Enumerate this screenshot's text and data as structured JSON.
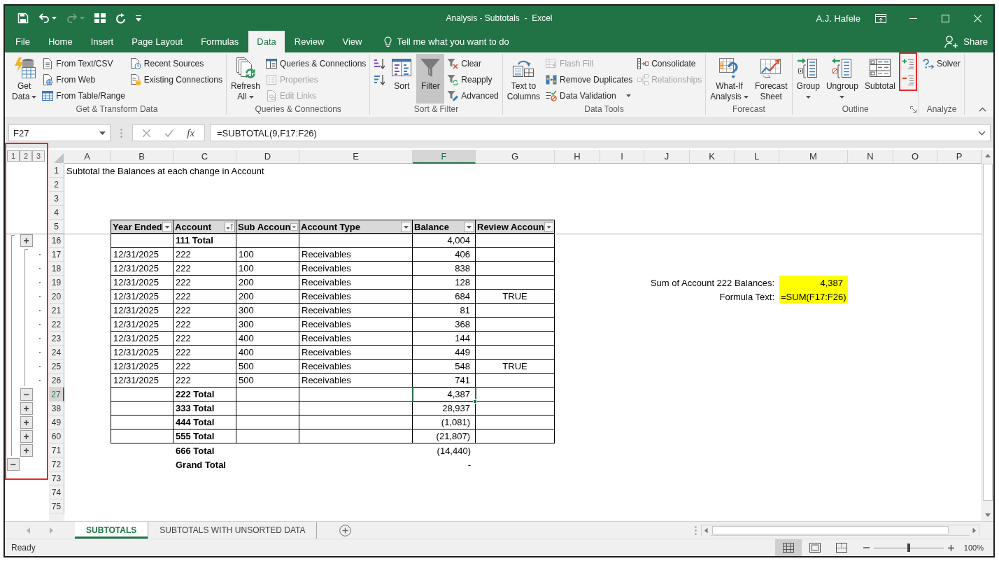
{
  "window": {
    "title": "Analysis - Subtotals  -  Excel",
    "user": "A.J. Hafele"
  },
  "quick_access": [
    {
      "kind": "save",
      "disabled": false
    },
    {
      "kind": "undo",
      "disabled": false,
      "dropdown": true
    },
    {
      "kind": "redo",
      "disabled": true,
      "dropdown": true
    },
    {
      "kind": "form",
      "disabled": false
    },
    {
      "kind": "refresh",
      "disabled": false
    },
    {
      "kind": "customize",
      "disabled": false
    }
  ],
  "tabs": [
    {
      "label": "File",
      "selected": false
    },
    {
      "label": "Home",
      "selected": false
    },
    {
      "label": "Insert",
      "selected": false
    },
    {
      "label": "Page Layout",
      "selected": false
    },
    {
      "label": "Formulas",
      "selected": false
    },
    {
      "label": "Data",
      "selected": true
    },
    {
      "label": "Review",
      "selected": false
    },
    {
      "label": "View",
      "selected": false
    }
  ],
  "tell_me": {
    "label": "Tell me what you want to do"
  },
  "share": {
    "label": "Share"
  },
  "ribbon": {
    "groups": [
      {
        "label": "Get & Transform Data",
        "columns": [
          {
            "kind": "large",
            "label": "Get\nData",
            "dropdown": true,
            "selected": false
          },
          {
            "kind": "stack",
            "items": [
              {
                "label": "From Text/CSV",
                "disabled": false
              },
              {
                "label": "From Web",
                "disabled": false
              },
              {
                "label": "From Table/Range",
                "disabled": false
              }
            ]
          },
          {
            "kind": "stack",
            "items": [
              {
                "label": "Recent Sources",
                "disabled": false
              },
              {
                "label": "Existing Connections",
                "disabled": false
              }
            ]
          }
        ]
      },
      {
        "label": "Queries & Connections",
        "columns": [
          {
            "kind": "large",
            "label": "Refresh\nAll",
            "dropdown": true,
            "selected": false
          },
          {
            "kind": "stack",
            "items": [
              {
                "label": "Queries & Connections",
                "disabled": false
              },
              {
                "label": "Properties",
                "disabled": true
              },
              {
                "label": "Edit Links",
                "disabled": true
              }
            ]
          }
        ]
      },
      {
        "label": "Sort & Filter",
        "columns": [
          {
            "kind": "stack",
            "items": [
              {
                "disabled": false
              },
              {
                "disabled": false
              }
            ]
          },
          {
            "kind": "large",
            "label": "Sort",
            "selected": false
          },
          {
            "kind": "large",
            "label": "Filter",
            "selected": true
          },
          {
            "kind": "stack",
            "items": [
              {
                "label": "Clear",
                "disabled": false
              },
              {
                "label": "Reapply",
                "disabled": false
              },
              {
                "label": "Advanced",
                "disabled": false
              }
            ]
          }
        ]
      },
      {
        "label": "Data Tools",
        "columns": [
          {
            "kind": "large",
            "label": "Text to\nColumns",
            "selected": false
          },
          {
            "kind": "stack",
            "items": [
              {
                "label": "Flash Fill",
                "disabled": true
              },
              {
                "label": "Remove Duplicates",
                "disabled": false
              },
              {
                "label": "Data Validation",
                "disabled": false,
                "dropdown": true
              }
            ]
          },
          {
            "kind": "stack",
            "items": [
              {
                "label": "Consolidate",
                "disabled": false
              },
              {
                "label": "Relationships",
                "disabled": true
              }
            ]
          }
        ]
      },
      {
        "label": "Forecast",
        "columns": [
          {
            "kind": "large",
            "label": "What-If\nAnalysis",
            "dropdown": true,
            "selected": false
          },
          {
            "kind": "large",
            "label": "Forecast\nSheet",
            "selected": false
          }
        ]
      },
      {
        "label": "Outline",
        "launcher": true,
        "columns": [
          {
            "kind": "large",
            "label": "Group",
            "dropdown": true,
            "selected": false
          },
          {
            "kind": "large",
            "label": "Ungroup",
            "dropdown": true,
            "selected": false
          },
          {
            "kind": "large",
            "label": "Subtotal",
            "selected": false
          },
          {
            "kind": "stack",
            "highlighted": true,
            "items": [
              {
                "disabled": false
              },
              {
                "disabled": false
              }
            ]
          }
        ]
      },
      {
        "label": "Analyze",
        "columns": [
          {
            "kind": "stack",
            "items": [
              {
                "label": "Solver",
                "disabled": false
              }
            ]
          }
        ]
      }
    ]
  },
  "formula_bar": {
    "name_box": "F27",
    "insert_function": "fx",
    "formula": "=SUBTOTAL(9,F17:F26)"
  },
  "sheet": {
    "outline": {
      "levels": [
        "1",
        "2",
        "3"
      ],
      "highlighted": true
    },
    "columns": [
      {
        "label": "A",
        "selected": false
      },
      {
        "label": "B",
        "selected": false
      },
      {
        "label": "C",
        "selected": false
      },
      {
        "label": "D",
        "selected": false
      },
      {
        "label": "E",
        "selected": false
      },
      {
        "label": "F",
        "selected": true
      },
      {
        "label": "G",
        "selected": false
      },
      {
        "label": "H",
        "selected": false
      },
      {
        "label": "I",
        "selected": false
      },
      {
        "label": "J",
        "selected": false
      },
      {
        "label": "K",
        "selected": false
      },
      {
        "label": "L",
        "selected": false
      },
      {
        "label": "M",
        "selected": false
      },
      {
        "label": "N",
        "selected": false
      },
      {
        "label": "O",
        "selected": false
      },
      {
        "label": "P",
        "selected": false
      }
    ],
    "rows": [
      {
        "number": "1",
        "selected": false,
        "kind": "text",
        "bordered": false,
        "note": "Subtotal the Balances at each change in Account"
      },
      {
        "number": "2",
        "selected": false,
        "kind": "blank",
        "bordered": false
      },
      {
        "number": "3",
        "selected": false,
        "kind": "blank",
        "bordered": false
      },
      {
        "number": "4",
        "selected": false,
        "kind": "blank",
        "bordered": false
      },
      {
        "number": "5",
        "selected": false,
        "kind": "header",
        "bordered": true,
        "freeze_line": true,
        "header": [
          {
            "label": "Year Ended",
            "sorted": false
          },
          {
            "label": "Account",
            "sorted": true
          },
          {
            "label": "Sub Accoun",
            "sorted": false
          },
          {
            "label": "Account Type",
            "sorted": false
          },
          {
            "label": "Balance",
            "sorted": false
          },
          {
            "label": "Review Accoun",
            "sorted": false
          }
        ]
      },
      {
        "number": "16",
        "selected": false,
        "kind": "total",
        "bordered": true,
        "outline": {
          "kind": "group",
          "symbol": "+"
        },
        "values": {
          "account": "111 Total",
          "balance": "4,004"
        }
      },
      {
        "number": "17",
        "selected": false,
        "kind": "detail",
        "bordered": true,
        "outline": {
          "kind": "detail"
        },
        "values": {
          "year_ended": "12/31/2025",
          "account": "222",
          "sub_account": "100",
          "account_type": "Receivables",
          "balance": "406"
        }
      },
      {
        "number": "18",
        "selected": false,
        "kind": "detail",
        "bordered": true,
        "outline": {
          "kind": "detail"
        },
        "values": {
          "year_ended": "12/31/2025",
          "account": "222",
          "sub_account": "100",
          "account_type": "Receivables",
          "balance": "838"
        }
      },
      {
        "number": "19",
        "selected": false,
        "kind": "detail",
        "bordered": true,
        "outline": {
          "kind": "detail"
        },
        "values": {
          "year_ended": "12/31/2025",
          "account": "222",
          "sub_account": "200",
          "account_type": "Receivables",
          "balance": "128"
        },
        "side": {
          "label": "Sum of Account 222 Balances:",
          "value": "4,387",
          "kind": "number",
          "highlighted": true
        }
      },
      {
        "number": "20",
        "selected": false,
        "kind": "detail",
        "bordered": true,
        "outline": {
          "kind": "detail"
        },
        "values": {
          "year_ended": "12/31/2025",
          "account": "222",
          "sub_account": "200",
          "account_type": "Receivables",
          "balance": "684",
          "review_account": "TRUE"
        },
        "side": {
          "label": "Formula Text:",
          "value": "=SUM(F17:F26)",
          "kind": "text",
          "highlighted": true
        }
      },
      {
        "number": "21",
        "selected": false,
        "kind": "detail",
        "bordered": true,
        "outline": {
          "kind": "detail"
        },
        "values": {
          "year_ended": "12/31/2025",
          "account": "222",
          "sub_account": "300",
          "account_type": "Receivables",
          "balance": "81"
        }
      },
      {
        "number": "22",
        "selected": false,
        "kind": "detail",
        "bordered": true,
        "outline": {
          "kind": "detail"
        },
        "values": {
          "year_ended": "12/31/2025",
          "account": "222",
          "sub_account": "300",
          "account_type": "Receivables",
          "balance": "368"
        }
      },
      {
        "number": "23",
        "selected": false,
        "kind": "detail",
        "bordered": true,
        "outline": {
          "kind": "detail"
        },
        "values": {
          "year_ended": "12/31/2025",
          "account": "222",
          "sub_account": "400",
          "account_type": "Receivables",
          "balance": "144"
        }
      },
      {
        "number": "24",
        "selected": false,
        "kind": "detail",
        "bordered": true,
        "outline": {
          "kind": "detail"
        },
        "values": {
          "year_ended": "12/31/2025",
          "account": "222",
          "sub_account": "400",
          "account_type": "Receivables",
          "balance": "449"
        }
      },
      {
        "number": "25",
        "selected": false,
        "kind": "detail",
        "bordered": true,
        "outline": {
          "kind": "detail"
        },
        "values": {
          "year_ended": "12/31/2025",
          "account": "222",
          "sub_account": "500",
          "account_type": "Receivables",
          "balance": "548",
          "review_account": "TRUE"
        }
      },
      {
        "number": "26",
        "selected": false,
        "kind": "detail",
        "bordered": true,
        "outline": {
          "kind": "detail"
        },
        "values": {
          "year_ended": "12/31/2025",
          "account": "222",
          "sub_account": "500",
          "account_type": "Receivables",
          "balance": "741"
        }
      },
      {
        "number": "27",
        "selected": true,
        "kind": "total",
        "bordered": true,
        "outline": {
          "kind": "group",
          "symbol": "−"
        },
        "values": {
          "account": "222 Total",
          "balance": "4,387"
        }
      },
      {
        "number": "38",
        "selected": false,
        "kind": "total",
        "bordered": true,
        "outline": {
          "kind": "group",
          "symbol": "+"
        },
        "values": {
          "account": "333 Total",
          "balance": "28,937"
        }
      },
      {
        "number": "49",
        "selected": false,
        "kind": "total",
        "bordered": true,
        "outline": {
          "kind": "group",
          "symbol": "+"
        },
        "values": {
          "account": "444 Total",
          "balance": "(1,081)"
        }
      },
      {
        "number": "60",
        "selected": false,
        "kind": "total",
        "bordered": true,
        "outline": {
          "kind": "group",
          "symbol": "+"
        },
        "values": {
          "account": "555 Total",
          "balance": "(21,807)"
        }
      },
      {
        "number": "71",
        "selected": false,
        "kind": "total",
        "bordered": false,
        "outline": {
          "kind": "group",
          "symbol": "+"
        },
        "values": {
          "account": "666 Total",
          "balance": "(14,440)"
        }
      },
      {
        "number": "72",
        "selected": false,
        "kind": "total",
        "bordered": false,
        "outline": {
          "kind": "grand",
          "symbol": "−"
        },
        "values": {
          "account": "Grand Total",
          "balance": "-"
        }
      },
      {
        "number": "73",
        "selected": false,
        "kind": "blank",
        "bordered": false
      },
      {
        "number": "74",
        "selected": false,
        "kind": "blank",
        "bordered": false
      },
      {
        "number": "75",
        "selected": false,
        "kind": "blank",
        "bordered": false
      }
    ]
  },
  "sheet_tabs": [
    {
      "label": "SUBTOTALS",
      "selected": true
    },
    {
      "label": "SUBTOTALS WITH UNSORTED DATA",
      "selected": false
    }
  ],
  "status_bar": {
    "text": "Ready",
    "views": [
      {
        "kind": "normal",
        "selected": true
      },
      {
        "kind": "page-layout",
        "selected": false
      },
      {
        "kind": "page-break",
        "selected": false
      }
    ],
    "zoom": {
      "level": 0.5,
      "reading": "100%"
    }
  }
}
